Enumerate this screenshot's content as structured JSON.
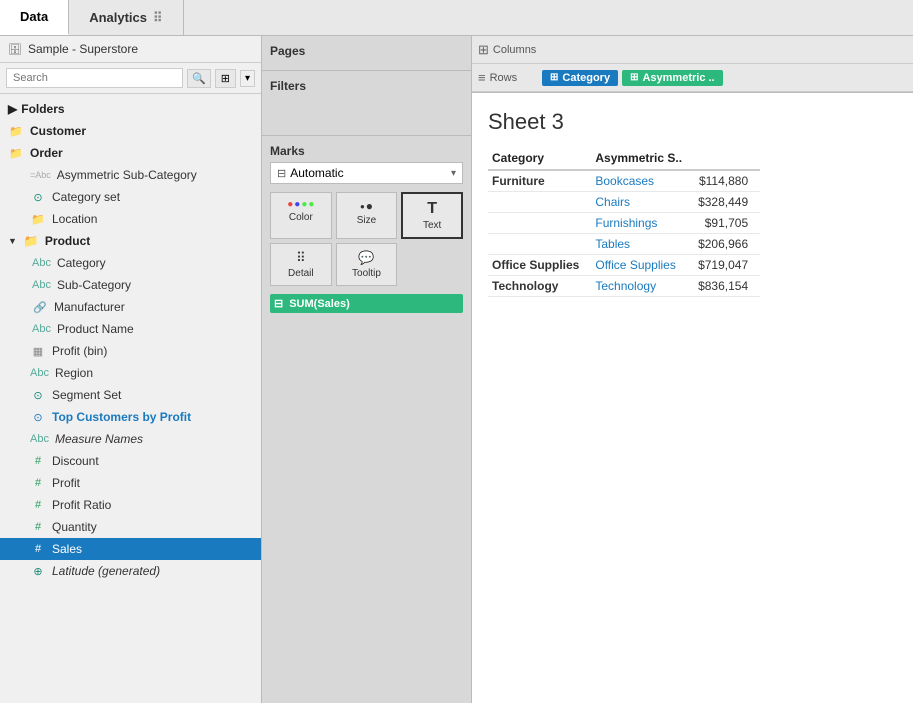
{
  "tabs": {
    "data_label": "Data",
    "analytics_label": "Analytics"
  },
  "datasource": {
    "name": "Sample - Superstore"
  },
  "search": {
    "placeholder": "Search",
    "button_label": "🔍"
  },
  "folders": {
    "header": "Folders",
    "items": [
      {
        "id": "customer",
        "label": "Customer",
        "type": "folder",
        "level": 0
      },
      {
        "id": "order",
        "label": "Order",
        "type": "folder",
        "level": 0
      },
      {
        "id": "asymmetric",
        "label": "Asymmetric Sub-Category",
        "type": "set",
        "level": 1
      },
      {
        "id": "category-set",
        "label": "Category set",
        "type": "set",
        "level": 1
      },
      {
        "id": "location",
        "label": "Location",
        "type": "folder-inner",
        "level": 1
      },
      {
        "id": "product",
        "label": "Product",
        "type": "folder-open",
        "level": 1
      },
      {
        "id": "category",
        "label": "Category",
        "type": "abc",
        "level": 2
      },
      {
        "id": "sub-category",
        "label": "Sub-Category",
        "type": "abc",
        "level": 2
      },
      {
        "id": "manufacturer",
        "label": "Manufacturer",
        "type": "paperclip",
        "level": 2
      },
      {
        "id": "product-name",
        "label": "Product Name",
        "type": "abc",
        "level": 2
      },
      {
        "id": "profit-bin",
        "label": "Profit (bin)",
        "type": "measure-bin",
        "level": 1
      },
      {
        "id": "region",
        "label": "Region",
        "type": "abc-plain",
        "level": 1
      },
      {
        "id": "segment-set",
        "label": "Segment Set",
        "type": "set",
        "level": 1
      },
      {
        "id": "top-customers",
        "label": "Top Customers by Profit",
        "type": "set-blue",
        "level": 1
      },
      {
        "id": "measure-names",
        "label": "Measure Names",
        "type": "abc-italic",
        "level": 1
      },
      {
        "id": "discount",
        "label": "Discount",
        "type": "hash",
        "level": 1
      },
      {
        "id": "profit",
        "label": "Profit",
        "type": "hash",
        "level": 1
      },
      {
        "id": "profit-ratio",
        "label": "Profit Ratio",
        "type": "hash",
        "level": 1
      },
      {
        "id": "quantity",
        "label": "Quantity",
        "type": "hash",
        "level": 1
      },
      {
        "id": "sales",
        "label": "Sales",
        "type": "hash",
        "level": 1,
        "selected": true
      },
      {
        "id": "latitude",
        "label": "Latitude (generated)",
        "type": "geo",
        "level": 1
      }
    ]
  },
  "pages_panel": {
    "title": "Pages"
  },
  "filters_panel": {
    "title": "Filters"
  },
  "marks_panel": {
    "title": "Marks",
    "dropdown": "Automatic",
    "buttons": [
      {
        "id": "color",
        "label": "Color",
        "icon": "⬤⬤"
      },
      {
        "id": "size",
        "label": "Size",
        "icon": "◎"
      },
      {
        "id": "text",
        "label": "Text",
        "icon": "T"
      },
      {
        "id": "detail",
        "label": "Detail",
        "icon": "⠿"
      },
      {
        "id": "tooltip",
        "label": "Tooltip",
        "icon": "💬"
      }
    ],
    "fields": [
      {
        "id": "sum-sales",
        "label": "SUM(Sales)",
        "icon": "#"
      }
    ]
  },
  "columns_shelf": {
    "label": "Columns",
    "pills": []
  },
  "rows_shelf": {
    "label": "Rows",
    "pills": [
      {
        "id": "category",
        "label": "Category",
        "type": "blue"
      },
      {
        "id": "asymmetric",
        "label": "Asymmetric ..",
        "type": "teal"
      }
    ]
  },
  "canvas": {
    "sheet_title": "Sheet 3",
    "table": {
      "headers": [
        "Category",
        "Asymmetric S.."
      ],
      "rows": [
        {
          "category": "Furniture",
          "category_bold": true,
          "subcategory": "Bookcases",
          "value": "$114,880"
        },
        {
          "category": "",
          "category_bold": false,
          "subcategory": "Chairs",
          "value": "$328,449"
        },
        {
          "category": "",
          "category_bold": false,
          "subcategory": "Furnishings",
          "value": "$91,705"
        },
        {
          "category": "",
          "category_bold": false,
          "subcategory": "Tables",
          "value": "$206,966"
        },
        {
          "category": "Office Supplies",
          "category_bold": true,
          "subcategory": "Office Supplies",
          "value": "$719,047"
        },
        {
          "category": "Technology",
          "category_bold": true,
          "subcategory": "Technology",
          "value": "$836,154"
        }
      ]
    }
  }
}
